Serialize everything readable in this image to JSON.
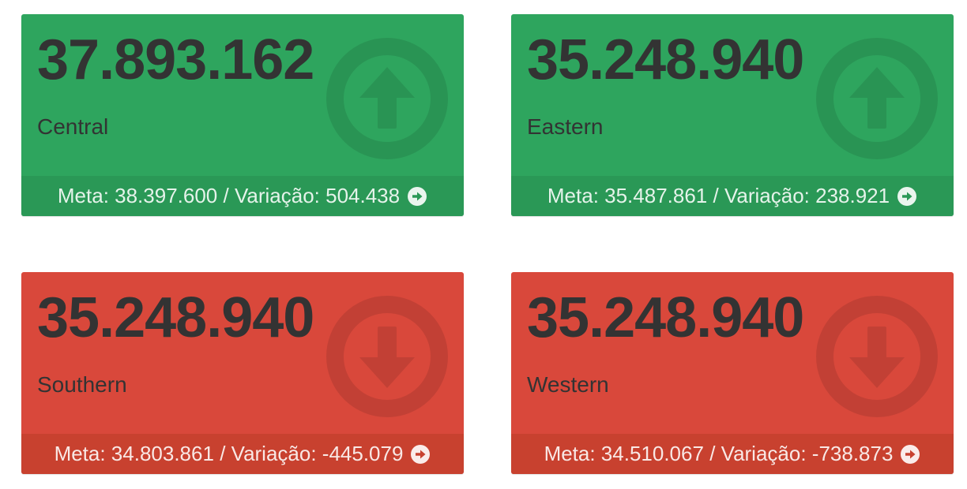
{
  "cards": [
    {
      "value": "37.893.162",
      "region": "Central",
      "meta": "Meta: 38.397.600",
      "separator": "/",
      "variation": "Variação: 504.438",
      "trend": "up",
      "trend_icon": "arrow-up-circle-icon",
      "color": "#2ea55e"
    },
    {
      "value": "35.248.940",
      "region": "Eastern",
      "meta": "Meta: 35.487.861",
      "separator": "/",
      "variation": "Variação: 238.921",
      "trend": "up",
      "trend_icon": "arrow-up-circle-icon",
      "color": "#2ea55e"
    },
    {
      "value": "35.248.940",
      "region": "Southern",
      "meta": "Meta: 34.803.861",
      "separator": "/",
      "variation": "Variação: -445.079",
      "trend": "down",
      "trend_icon": "arrow-down-circle-icon",
      "color": "#d9483b"
    },
    {
      "value": "35.248.940",
      "region": "Western",
      "meta": "Meta: 34.510.067",
      "separator": "/",
      "variation": "Variação: -738.873",
      "trend": "down",
      "trend_icon": "arrow-down-circle-icon",
      "color": "#d9483b"
    }
  ],
  "footer_icon": "arrow-circle-right-icon"
}
